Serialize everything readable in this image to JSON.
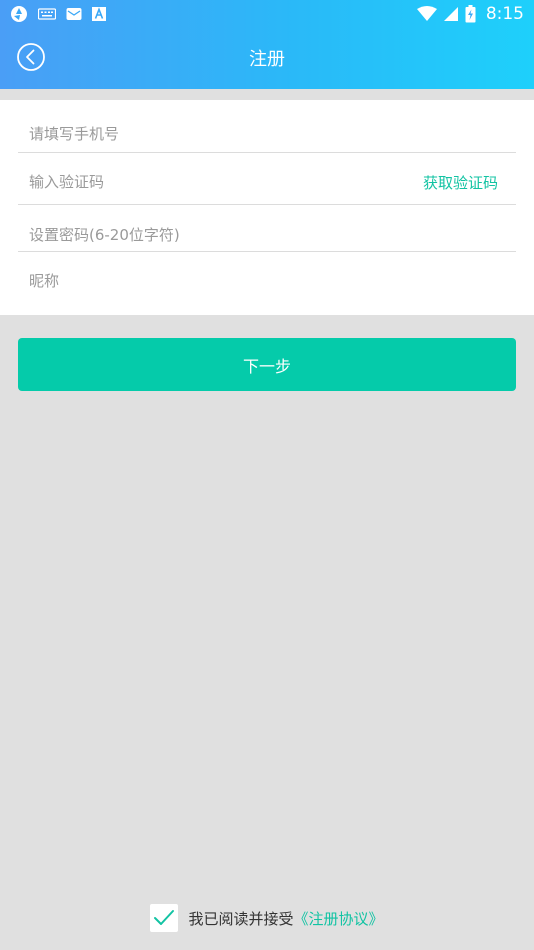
{
  "status_bar": {
    "time": "8:15",
    "left_icons": [
      "aperture-icon",
      "keyboard-icon",
      "mail-icon",
      "font-a-icon"
    ],
    "right_icons": [
      "wifi-icon",
      "signal-icon",
      "battery-icon"
    ]
  },
  "header": {
    "title": "注册",
    "back_icon": "back-circle-icon",
    "gradient": [
      "#4a9ef6",
      "#1ed0fb"
    ]
  },
  "form": {
    "phone_placeholder": "请填写手机号",
    "code_placeholder": "输入验证码",
    "get_code_label": "获取验证码",
    "password_placeholder": "设置密码(6-20位字符)",
    "nickname_placeholder": "昵称"
  },
  "actions": {
    "next_label": "下一步"
  },
  "agreement": {
    "checked": true,
    "text": "我已阅读并接受",
    "link": "《注册协议》"
  },
  "colors": {
    "accent": "#05cbaa",
    "link": "#12c3a3",
    "background": "#e0e0e0"
  }
}
